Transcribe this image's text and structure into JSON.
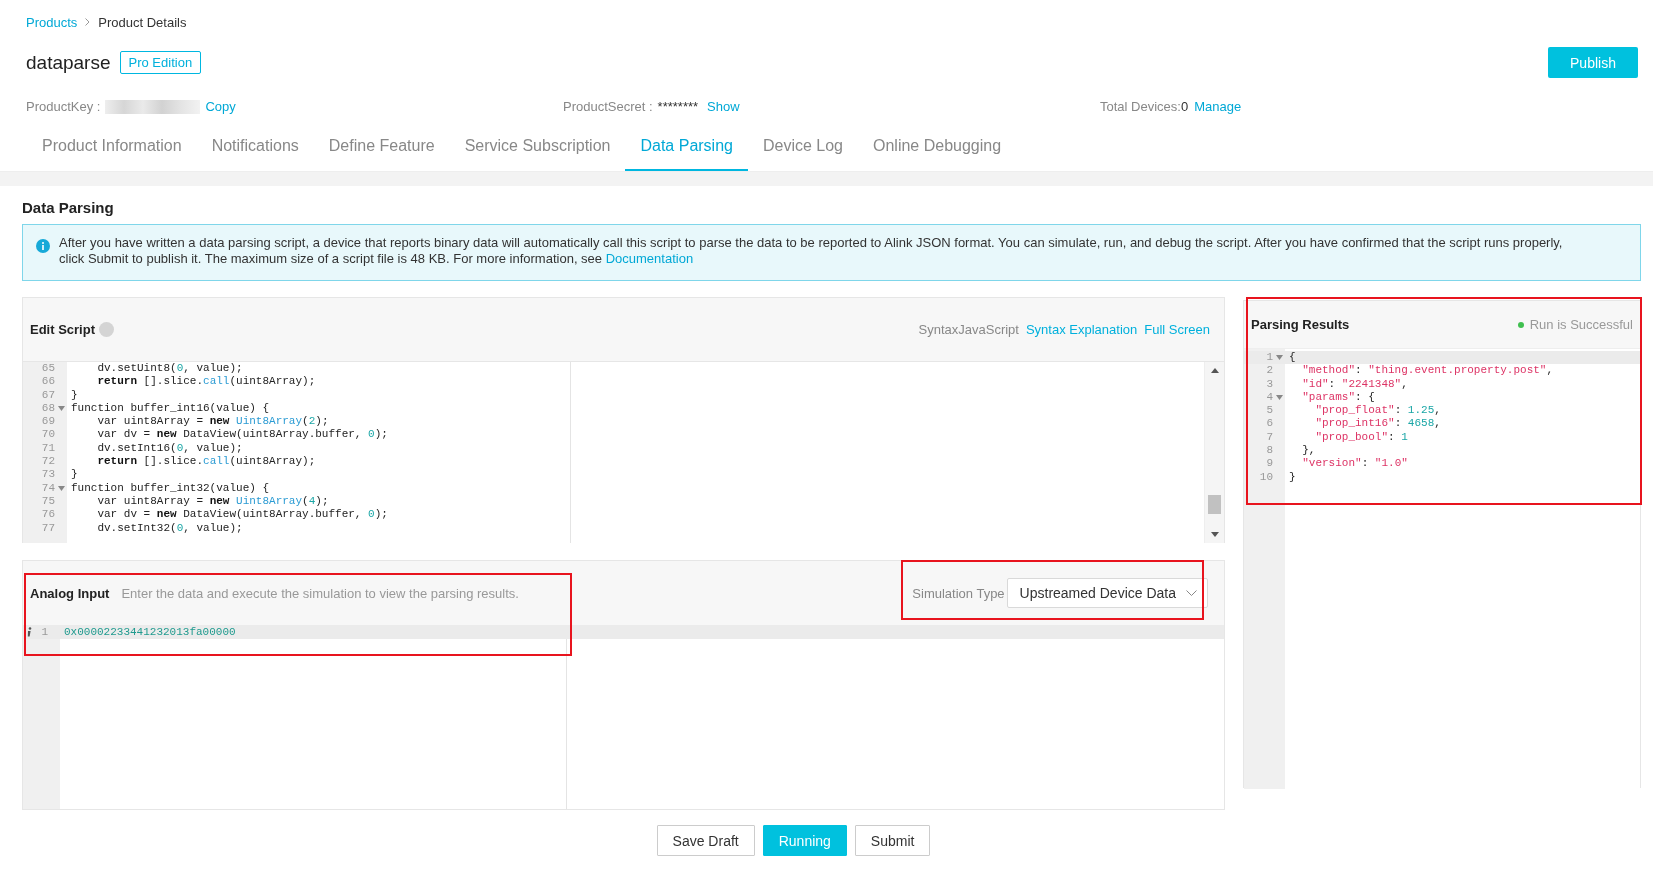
{
  "breadcrumb": [
    {
      "label": "Products",
      "kind": "link"
    },
    {
      "label": "Product Details",
      "kind": "current"
    }
  ],
  "product": {
    "name": "dataparse",
    "edition": "Pro Edition"
  },
  "publish_button": "Publish",
  "info": {
    "product_key_label": "ProductKey :",
    "copy_link": "Copy",
    "product_secret_label": "ProductSecret :",
    "product_secret_value": "********",
    "show_link": "Show",
    "total_devices_label": "Total Devices:",
    "total_devices_value": "0",
    "manage_link": "Manage"
  },
  "tabs": [
    {
      "label": "Product Information",
      "selected": false
    },
    {
      "label": "Notifications",
      "selected": false
    },
    {
      "label": "Define Feature",
      "selected": false
    },
    {
      "label": "Service Subscription",
      "selected": false
    },
    {
      "label": "Data Parsing",
      "selected": true
    },
    {
      "label": "Device Log",
      "selected": false
    },
    {
      "label": "Online Debugging",
      "selected": false
    }
  ],
  "section_title": "Data Parsing",
  "notice": {
    "text": "After you have written a data parsing script, a device that reports binary data will automatically call this script to parse the data to be reported to Alink JSON format. You can simulate, run, and debug the script. After you have confirmed that the script runs properly, click Submit to publish it. The maximum size of a script file is 48 KB. For more information, see",
    "link": "Documentation"
  },
  "script_editor": {
    "title": "Edit Script",
    "syntax_label": "SyntaxJavaScript",
    "links": [
      "Syntax Explanation",
      "Full Screen"
    ],
    "lines": [
      {
        "number": "65",
        "foldable": false,
        "tokens": [
          {
            "kind": "plain",
            "text": "    dv.setUint8("
          },
          {
            "kind": "number",
            "text": "0"
          },
          {
            "kind": "plain",
            "text": ", value);"
          }
        ]
      },
      {
        "number": "66",
        "foldable": false,
        "tokens": [
          {
            "kind": "keyword",
            "text": "    return"
          },
          {
            "kind": "plain",
            "text": " [].slice."
          },
          {
            "kind": "builtin",
            "text": "call"
          },
          {
            "kind": "plain",
            "text": "(uint8Array);"
          }
        ]
      },
      {
        "number": "67",
        "foldable": false,
        "tokens": [
          {
            "kind": "plain",
            "text": "}"
          }
        ]
      },
      {
        "number": "68",
        "foldable": true,
        "tokens": [
          {
            "kind": "plain",
            "text": "function buffer_int16(value) {"
          }
        ]
      },
      {
        "number": "69",
        "foldable": false,
        "tokens": [
          {
            "kind": "plain",
            "text": "    var uint8Array = "
          },
          {
            "kind": "keyword",
            "text": "new"
          },
          {
            "kind": "builtin",
            "text": " Uint8Array"
          },
          {
            "kind": "plain",
            "text": "("
          },
          {
            "kind": "number",
            "text": "2"
          },
          {
            "kind": "plain",
            "text": ");"
          }
        ]
      },
      {
        "number": "70",
        "foldable": false,
        "tokens": [
          {
            "kind": "plain",
            "text": "    var dv = "
          },
          {
            "kind": "keyword",
            "text": "new"
          },
          {
            "kind": "plain",
            "text": " DataView(uint8Array.buffer, "
          },
          {
            "kind": "number",
            "text": "0"
          },
          {
            "kind": "plain",
            "text": ");"
          }
        ]
      },
      {
        "number": "71",
        "foldable": false,
        "tokens": [
          {
            "kind": "plain",
            "text": "    dv.setInt16("
          },
          {
            "kind": "number",
            "text": "0"
          },
          {
            "kind": "plain",
            "text": ", value);"
          }
        ]
      },
      {
        "number": "72",
        "foldable": false,
        "tokens": [
          {
            "kind": "keyword",
            "text": "    return"
          },
          {
            "kind": "plain",
            "text": " [].slice."
          },
          {
            "kind": "builtin",
            "text": "call"
          },
          {
            "kind": "plain",
            "text": "(uint8Array);"
          }
        ]
      },
      {
        "number": "73",
        "foldable": false,
        "tokens": [
          {
            "kind": "plain",
            "text": "}"
          }
        ]
      },
      {
        "number": "74",
        "foldable": true,
        "tokens": [
          {
            "kind": "plain",
            "text": "function buffer_int32(value) {"
          }
        ]
      },
      {
        "number": "75",
        "foldable": false,
        "tokens": [
          {
            "kind": "plain",
            "text": "    var uint8Array = "
          },
          {
            "kind": "keyword",
            "text": "new"
          },
          {
            "kind": "builtin",
            "text": " Uint8Array"
          },
          {
            "kind": "plain",
            "text": "("
          },
          {
            "kind": "number",
            "text": "4"
          },
          {
            "kind": "plain",
            "text": ");"
          }
        ]
      },
      {
        "number": "76",
        "foldable": false,
        "tokens": [
          {
            "kind": "plain",
            "text": "    var dv = "
          },
          {
            "kind": "keyword",
            "text": "new"
          },
          {
            "kind": "plain",
            "text": " DataView(uint8Array.buffer, "
          },
          {
            "kind": "number",
            "text": "0"
          },
          {
            "kind": "plain",
            "text": ");"
          }
        ]
      },
      {
        "number": "77",
        "foldable": false,
        "tokens": [
          {
            "kind": "plain",
            "text": "    dv.setInt32("
          },
          {
            "kind": "number",
            "text": "0"
          },
          {
            "kind": "plain",
            "text": ", value);"
          }
        ]
      }
    ]
  },
  "analog_input": {
    "title": "Analog Input",
    "hint": "Enter the data and execute the simulation to view the parsing results.",
    "highlighted": true,
    "lines": [
      {
        "number": "1",
        "annotated": true,
        "active": true,
        "tokens": [
          {
            "kind": "string_teal",
            "text": "0x00002233441232013fa00000"
          }
        ]
      }
    ],
    "simulation_type": {
      "label": "Simulation Type",
      "value": "Upstreamed Device Data",
      "highlighted": true
    }
  },
  "parsing_results": {
    "title": "Parsing Results",
    "status": "Run is Successful",
    "succeeded": true,
    "highlighted": true,
    "lines": [
      {
        "number": "1",
        "foldable": true,
        "active": true,
        "tokens": [
          {
            "kind": "plain",
            "text": "{"
          }
        ]
      },
      {
        "number": "2",
        "foldable": false,
        "active": false,
        "tokens": [
          {
            "kind": "string",
            "text": "  \"method\""
          },
          {
            "kind": "plain",
            "text": ": "
          },
          {
            "kind": "string",
            "text": "\"thing.event.property.post\""
          },
          {
            "kind": "plain",
            "text": ","
          }
        ]
      },
      {
        "number": "3",
        "foldable": false,
        "active": false,
        "tokens": [
          {
            "kind": "string",
            "text": "  \"id\""
          },
          {
            "kind": "plain",
            "text": ": "
          },
          {
            "kind": "string",
            "text": "\"2241348\""
          },
          {
            "kind": "plain",
            "text": ","
          }
        ]
      },
      {
        "number": "4",
        "foldable": true,
        "active": false,
        "tokens": [
          {
            "kind": "string",
            "text": "  \"params\""
          },
          {
            "kind": "plain",
            "text": ": {"
          }
        ]
      },
      {
        "number": "5",
        "foldable": false,
        "active": false,
        "tokens": [
          {
            "kind": "string",
            "text": "    \"prop_float\""
          },
          {
            "kind": "plain",
            "text": ": "
          },
          {
            "kind": "number",
            "text": "1.25"
          },
          {
            "kind": "plain",
            "text": ","
          }
        ]
      },
      {
        "number": "6",
        "foldable": false,
        "active": false,
        "tokens": [
          {
            "kind": "string",
            "text": "    \"prop_int16\""
          },
          {
            "kind": "plain",
            "text": ": "
          },
          {
            "kind": "number",
            "text": "4658"
          },
          {
            "kind": "plain",
            "text": ","
          }
        ]
      },
      {
        "number": "7",
        "foldable": false,
        "active": false,
        "tokens": [
          {
            "kind": "string",
            "text": "    \"prop_bool\""
          },
          {
            "kind": "plain",
            "text": ": "
          },
          {
            "kind": "number",
            "text": "1"
          }
        ]
      },
      {
        "number": "8",
        "foldable": false,
        "active": false,
        "tokens": [
          {
            "kind": "plain",
            "text": "  },"
          }
        ]
      },
      {
        "number": "9",
        "foldable": false,
        "active": false,
        "tokens": [
          {
            "kind": "string",
            "text": "  \"version\""
          },
          {
            "kind": "plain",
            "text": ": "
          },
          {
            "kind": "string",
            "text": "\"1.0\""
          }
        ]
      },
      {
        "number": "10",
        "foldable": false,
        "active": false,
        "tokens": [
          {
            "kind": "plain",
            "text": "}"
          }
        ]
      }
    ]
  },
  "buttons": [
    {
      "label": "Save Draft",
      "kind": "default"
    },
    {
      "label": "Running",
      "kind": "primary"
    },
    {
      "label": "Submit",
      "kind": "default"
    }
  ]
}
